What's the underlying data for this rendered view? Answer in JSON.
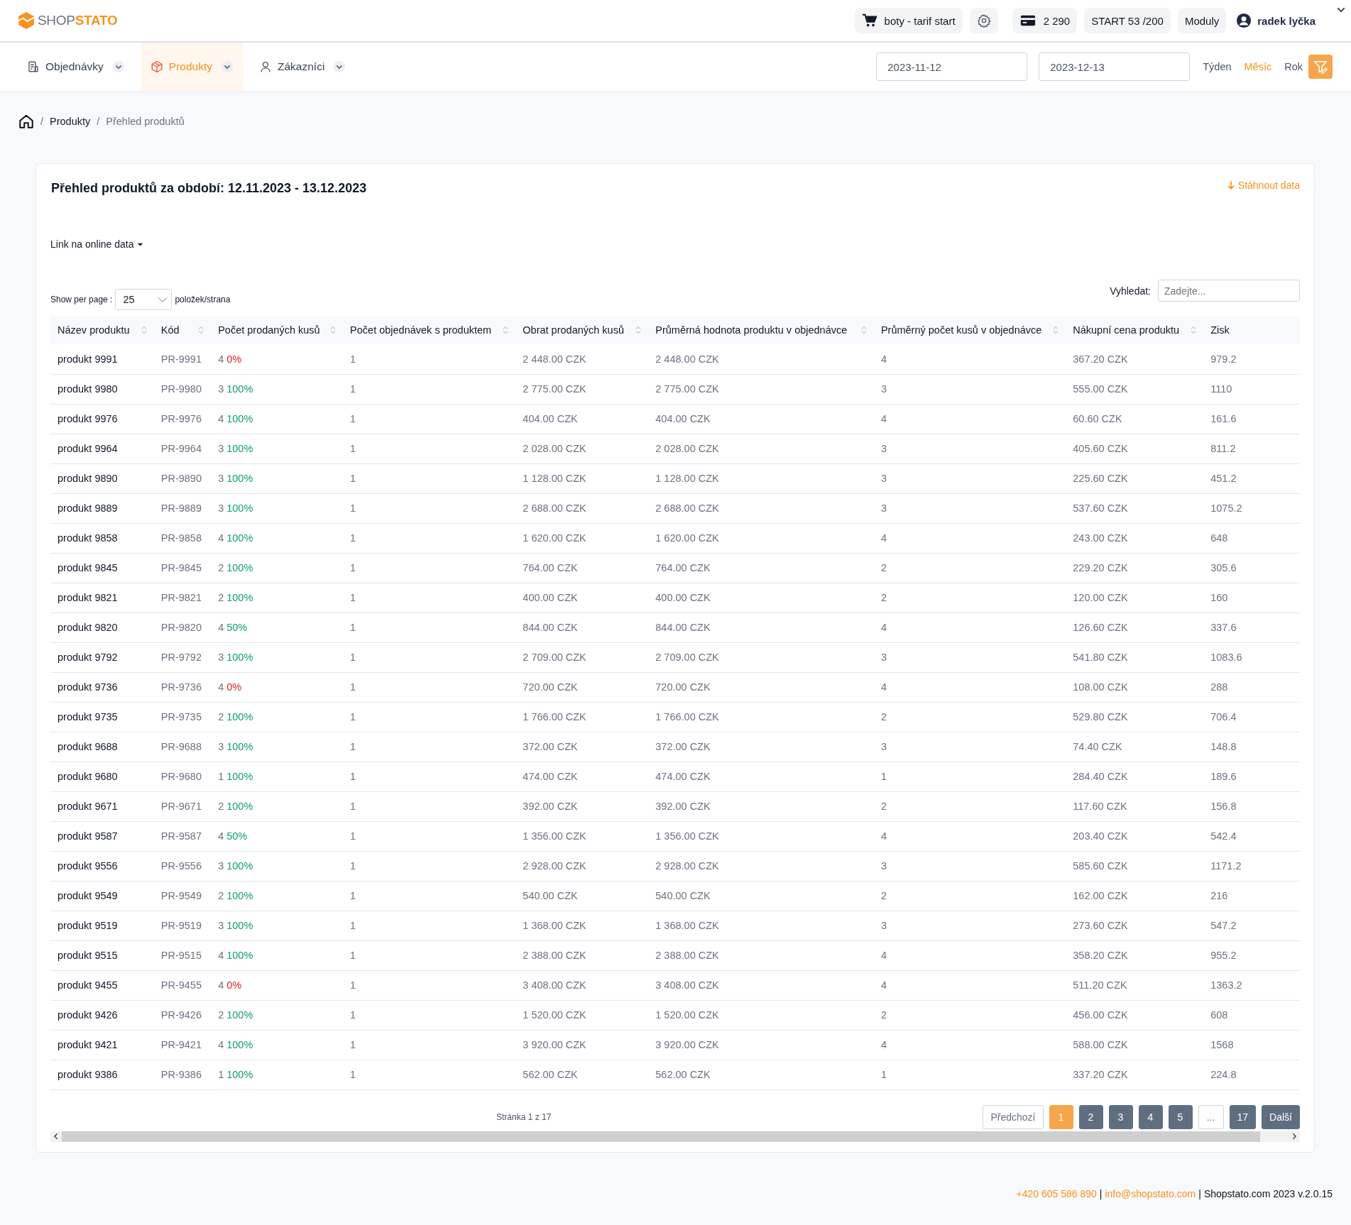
{
  "header": {
    "logo": {
      "part1": "SHOP",
      "part2": "STATO"
    },
    "shop": "boty - tarif start",
    "credit": "2 290",
    "plan": "START 53 /200",
    "modules": "Moduly",
    "user": "radek lyčka"
  },
  "nav": {
    "tabs": [
      {
        "label": "Objednávky",
        "selected": false
      },
      {
        "label": "Produkty",
        "selected": true
      },
      {
        "label": "Zákazníci",
        "selected": false
      }
    ],
    "date_from": "2023-11-12",
    "date_to": "2023-12-13",
    "periods": [
      {
        "label": "Týden",
        "selected": false
      },
      {
        "label": "Měsíc",
        "selected": true
      },
      {
        "label": "Rok",
        "selected": false
      }
    ]
  },
  "breadcrumb": {
    "separator": "/",
    "items": [
      "Produkty",
      "Přehled produktů"
    ]
  },
  "card": {
    "title": "Přehled produktů za období: 12.11.2023 - 13.12.2023",
    "download": "Stáhnout data",
    "link_menu": "Link na online data",
    "per_page_label": "Show per page :",
    "per_page": "25",
    "per_page_suffix": "položek/strana",
    "search_label": "Vyhledat:",
    "search_placeholder": "Zadejte...",
    "columns": [
      {
        "label": "Název produktu",
        "sortable": true
      },
      {
        "label": "Kód",
        "sortable": true
      },
      {
        "label": "Počet prodaných kusů",
        "sortable": true
      },
      {
        "label": "Počet objednávek s produktem",
        "sortable": true
      },
      {
        "label": "Obrat prodaných kusů",
        "sortable": true
      },
      {
        "label": "Průměrná hodnota produktu v objednávce",
        "sortable": true
      },
      {
        "label": "Průměrný počet kusů v objednávce",
        "sortable": true
      },
      {
        "label": "Nákupní cena produktu",
        "sortable": true
      },
      {
        "label": "Zisk",
        "sortable": false
      }
    ],
    "rows": [
      {
        "name": "produkt 9991",
        "code": "PR-9991",
        "qty": "4",
        "pct": "0%",
        "color": "#e02424",
        "orders": "1",
        "revenue": "2 448.00 CZK",
        "avg_value": "2 448.00 CZK",
        "avg_qty": "4",
        "cost": "367.20 CZK",
        "profit": "979.2"
      },
      {
        "name": "produkt 9980",
        "code": "PR-9980",
        "qty": "3",
        "pct": "100%",
        "color": "#0e9f6e",
        "orders": "1",
        "revenue": "2 775.00 CZK",
        "avg_value": "2 775.00 CZK",
        "avg_qty": "3",
        "cost": "555.00 CZK",
        "profit": "1110"
      },
      {
        "name": "produkt 9976",
        "code": "PR-9976",
        "qty": "4",
        "pct": "100%",
        "color": "#0e9f6e",
        "orders": "1",
        "revenue": "404.00 CZK",
        "avg_value": "404.00 CZK",
        "avg_qty": "4",
        "cost": "60.60 CZK",
        "profit": "161.6"
      },
      {
        "name": "produkt 9964",
        "code": "PR-9964",
        "qty": "3",
        "pct": "100%",
        "color": "#0e9f6e",
        "orders": "1",
        "revenue": "2 028.00 CZK",
        "avg_value": "2 028.00 CZK",
        "avg_qty": "3",
        "cost": "405.60 CZK",
        "profit": "811.2"
      },
      {
        "name": "produkt 9890",
        "code": "PR-9890",
        "qty": "3",
        "pct": "100%",
        "color": "#0e9f6e",
        "orders": "1",
        "revenue": "1 128.00 CZK",
        "avg_value": "1 128.00 CZK",
        "avg_qty": "3",
        "cost": "225.60 CZK",
        "profit": "451.2"
      },
      {
        "name": "produkt 9889",
        "code": "PR-9889",
        "qty": "3",
        "pct": "100%",
        "color": "#0e9f6e",
        "orders": "1",
        "revenue": "2 688.00 CZK",
        "avg_value": "2 688.00 CZK",
        "avg_qty": "3",
        "cost": "537.60 CZK",
        "profit": "1075.2"
      },
      {
        "name": "produkt 9858",
        "code": "PR-9858",
        "qty": "4",
        "pct": "100%",
        "color": "#0e9f6e",
        "orders": "1",
        "revenue": "1 620.00 CZK",
        "avg_value": "1 620.00 CZK",
        "avg_qty": "4",
        "cost": "243.00 CZK",
        "profit": "648"
      },
      {
        "name": "produkt 9845",
        "code": "PR-9845",
        "qty": "2",
        "pct": "100%",
        "color": "#0e9f6e",
        "orders": "1",
        "revenue": "764.00 CZK",
        "avg_value": "764.00 CZK",
        "avg_qty": "2",
        "cost": "229.20 CZK",
        "profit": "305.6"
      },
      {
        "name": "produkt 9821",
        "code": "PR-9821",
        "qty": "2",
        "pct": "100%",
        "color": "#0e9f6e",
        "orders": "1",
        "revenue": "400.00 CZK",
        "avg_value": "400.00 CZK",
        "avg_qty": "2",
        "cost": "120.00 CZK",
        "profit": "160"
      },
      {
        "name": "produkt 9820",
        "code": "PR-9820",
        "qty": "4",
        "pct": "50%",
        "color": "#0e9f6e",
        "orders": "1",
        "revenue": "844.00 CZK",
        "avg_value": "844.00 CZK",
        "avg_qty": "4",
        "cost": "126.60 CZK",
        "profit": "337.6"
      },
      {
        "name": "produkt 9792",
        "code": "PR-9792",
        "qty": "3",
        "pct": "100%",
        "color": "#0e9f6e",
        "orders": "1",
        "revenue": "2 709.00 CZK",
        "avg_value": "2 709.00 CZK",
        "avg_qty": "3",
        "cost": "541.80 CZK",
        "profit": "1083.6"
      },
      {
        "name": "produkt 9736",
        "code": "PR-9736",
        "qty": "4",
        "pct": "0%",
        "color": "#e02424",
        "orders": "1",
        "revenue": "720.00 CZK",
        "avg_value": "720.00 CZK",
        "avg_qty": "4",
        "cost": "108.00 CZK",
        "profit": "288"
      },
      {
        "name": "produkt 9735",
        "code": "PR-9735",
        "qty": "2",
        "pct": "100%",
        "color": "#0e9f6e",
        "orders": "1",
        "revenue": "1 766.00 CZK",
        "avg_value": "1 766.00 CZK",
        "avg_qty": "2",
        "cost": "529.80 CZK",
        "profit": "706.4"
      },
      {
        "name": "produkt 9688",
        "code": "PR-9688",
        "qty": "3",
        "pct": "100%",
        "color": "#0e9f6e",
        "orders": "1",
        "revenue": "372.00 CZK",
        "avg_value": "372.00 CZK",
        "avg_qty": "3",
        "cost": "74.40 CZK",
        "profit": "148.8"
      },
      {
        "name": "produkt 9680",
        "code": "PR-9680",
        "qty": "1",
        "pct": "100%",
        "color": "#0e9f6e",
        "orders": "1",
        "revenue": "474.00 CZK",
        "avg_value": "474.00 CZK",
        "avg_qty": "1",
        "cost": "284.40 CZK",
        "profit": "189.6"
      },
      {
        "name": "produkt 9671",
        "code": "PR-9671",
        "qty": "2",
        "pct": "100%",
        "color": "#0e9f6e",
        "orders": "1",
        "revenue": "392.00 CZK",
        "avg_value": "392.00 CZK",
        "avg_qty": "2",
        "cost": "117.60 CZK",
        "profit": "156.8"
      },
      {
        "name": "produkt 9587",
        "code": "PR-9587",
        "qty": "4",
        "pct": "50%",
        "color": "#0e9f6e",
        "orders": "1",
        "revenue": "1 356.00 CZK",
        "avg_value": "1 356.00 CZK",
        "avg_qty": "4",
        "cost": "203.40 CZK",
        "profit": "542.4"
      },
      {
        "name": "produkt 9556",
        "code": "PR-9556",
        "qty": "3",
        "pct": "100%",
        "color": "#0e9f6e",
        "orders": "1",
        "revenue": "2 928.00 CZK",
        "avg_value": "2 928.00 CZK",
        "avg_qty": "3",
        "cost": "585.60 CZK",
        "profit": "1171.2"
      },
      {
        "name": "produkt 9549",
        "code": "PR-9549",
        "qty": "2",
        "pct": "100%",
        "color": "#0e9f6e",
        "orders": "1",
        "revenue": "540.00 CZK",
        "avg_value": "540.00 CZK",
        "avg_qty": "2",
        "cost": "162.00 CZK",
        "profit": "216"
      },
      {
        "name": "produkt 9519",
        "code": "PR-9519",
        "qty": "3",
        "pct": "100%",
        "color": "#0e9f6e",
        "orders": "1",
        "revenue": "1 368.00 CZK",
        "avg_value": "1 368.00 CZK",
        "avg_qty": "3",
        "cost": "273.60 CZK",
        "profit": "547.2"
      },
      {
        "name": "produkt 9515",
        "code": "PR-9515",
        "qty": "4",
        "pct": "100%",
        "color": "#0e9f6e",
        "orders": "1",
        "revenue": "2 388.00 CZK",
        "avg_value": "2 388.00 CZK",
        "avg_qty": "4",
        "cost": "358.20 CZK",
        "profit": "955.2"
      },
      {
        "name": "produkt 9455",
        "code": "PR-9455",
        "qty": "4",
        "pct": "0%",
        "color": "#e02424",
        "orders": "1",
        "revenue": "3 408.00 CZK",
        "avg_value": "3 408.00 CZK",
        "avg_qty": "4",
        "cost": "511.20 CZK",
        "profit": "1363.2"
      },
      {
        "name": "produkt 9426",
        "code": "PR-9426",
        "qty": "2",
        "pct": "100%",
        "color": "#0e9f6e",
        "orders": "1",
        "revenue": "1 520.00 CZK",
        "avg_value": "1 520.00 CZK",
        "avg_qty": "2",
        "cost": "456.00 CZK",
        "profit": "608"
      },
      {
        "name": "produkt 9421",
        "code": "PR-9421",
        "qty": "4",
        "pct": "100%",
        "color": "#0e9f6e",
        "orders": "1",
        "revenue": "3 920.00 CZK",
        "avg_value": "3 920.00 CZK",
        "avg_qty": "4",
        "cost": "588.00 CZK",
        "profit": "1568"
      },
      {
        "name": "produkt 9386",
        "code": "PR-9386",
        "qty": "1",
        "pct": "100%",
        "color": "#0e9f6e",
        "orders": "1",
        "revenue": "562.00 CZK",
        "avg_value": "562.00 CZK",
        "avg_qty": "1",
        "cost": "337.20 CZK",
        "profit": "224.8"
      }
    ],
    "page_info": "Stránka 1 z 17",
    "pagination": [
      {
        "label": "Předchozí",
        "kind": "nav",
        "selected": false
      },
      {
        "label": "1",
        "kind": "page",
        "selected": true
      },
      {
        "label": "2",
        "kind": "page",
        "selected": false
      },
      {
        "label": "3",
        "kind": "page",
        "selected": false
      },
      {
        "label": "4",
        "kind": "page",
        "selected": false
      },
      {
        "label": "5",
        "kind": "page",
        "selected": false
      },
      {
        "label": "...",
        "kind": "gap",
        "selected": false
      },
      {
        "label": "17",
        "kind": "page",
        "selected": false
      },
      {
        "label": "Další",
        "kind": "page",
        "selected": false
      }
    ]
  },
  "footer": {
    "separator": "|",
    "phone": "+420 605 586 890",
    "email": "info@shopstato.com",
    "copyright": "Shopstato.com 2023 v.2.0.15"
  }
}
